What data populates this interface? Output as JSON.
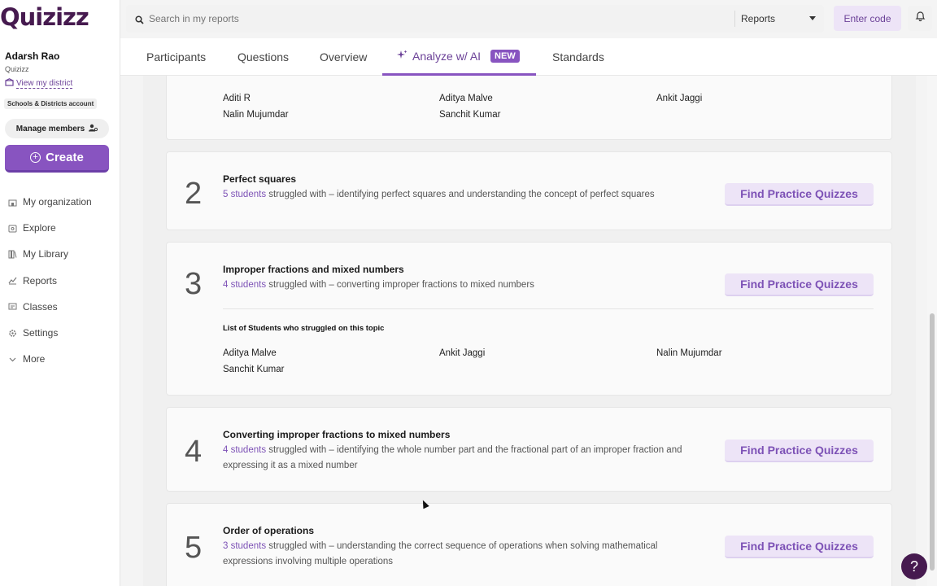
{
  "brand": {
    "logo_text": "Quizizz"
  },
  "user": {
    "name": "Adarsh Rao",
    "org": "Quizizz",
    "district_link": "View my district",
    "account_type": "Schools & Districts account",
    "manage_members": "Manage members"
  },
  "create_label": "Create",
  "nav": [
    {
      "label": "My organization",
      "icon": "building-icon"
    },
    {
      "label": "Explore",
      "icon": "compass-icon"
    },
    {
      "label": "My Library",
      "icon": "library-icon"
    },
    {
      "label": "Reports",
      "icon": "chart-icon"
    },
    {
      "label": "Classes",
      "icon": "classes-icon"
    },
    {
      "label": "Settings",
      "icon": "gear-icon"
    },
    {
      "label": "More",
      "icon": "chevron-down-icon"
    }
  ],
  "search": {
    "placeholder": "Search in my reports",
    "scope": "Reports"
  },
  "header": {
    "enter_code": "Enter code"
  },
  "tabs": [
    {
      "label": "Participants"
    },
    {
      "label": "Questions"
    },
    {
      "label": "Overview"
    },
    {
      "label": "Analyze w/ AI",
      "badge": "NEW",
      "active": true
    },
    {
      "label": "Standards"
    }
  ],
  "card1": {
    "names": [
      "Aditi R",
      "Aditya Malve",
      "Ankit Jaggi",
      "Nalin Mujumdar",
      "Sanchit Kumar"
    ]
  },
  "topics": [
    {
      "number": "2",
      "title": "Perfect squares",
      "students": "5 students",
      "desc": " struggled with – identifying perfect squares and understanding the concept of perfect squares",
      "button": "Find Practice Quizzes"
    },
    {
      "number": "3",
      "title": "Improper fractions and mixed numbers",
      "students": "4 students",
      "desc": " struggled with – converting improper fractions to mixed numbers",
      "button": "Find Practice Quizzes",
      "list_head": "List of Students who struggled on this topic",
      "names": [
        "Aditya Malve",
        "Ankit Jaggi",
        "Nalin Mujumdar",
        "Sanchit Kumar"
      ]
    },
    {
      "number": "4",
      "title": "Converting improper fractions to mixed numbers",
      "students": "4 students",
      "desc": " struggled with – identifying the whole number part and the fractional part of an improper fraction and expressing it as a mixed number",
      "button": "Find Practice Quizzes"
    },
    {
      "number": "5",
      "title": "Order of operations",
      "students": "3 students",
      "desc": " struggled with – understanding the correct sequence of operations when solving mathematical expressions involving multiple operations",
      "button": "Find Practice Quizzes"
    }
  ],
  "help_label": "?",
  "colors": {
    "brand_dark": "#461a4f",
    "accent": "#8854c0",
    "accent_light": "#ede4f7"
  }
}
